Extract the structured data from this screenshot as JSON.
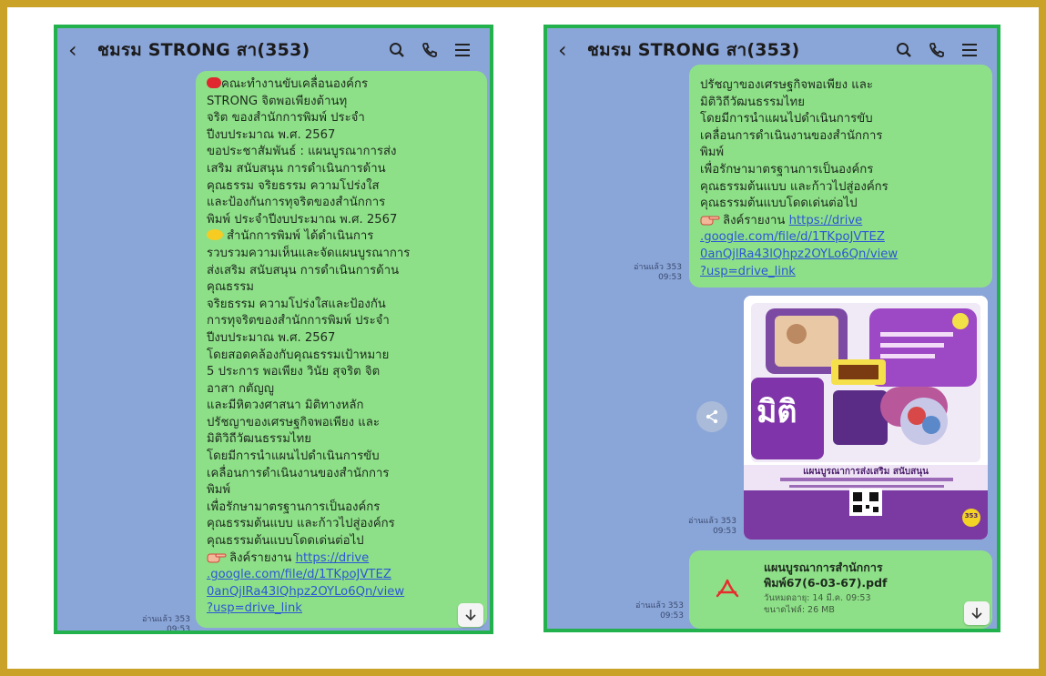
{
  "header": {
    "title": "ชมรม STRONG สา(353)"
  },
  "left": {
    "lines": [
      "คณะทำงานขับเคลื่อนองค์กร",
      "STRONG จิตพอเพียงต้านทุ",
      "จริต ของสำนักการพิมพ์ ประจำ",
      "ปีงบประมาณ พ.ศ. 2567",
      "ขอประชาสัมพันธ์ : แผนบูรณาการส่ง",
      "เสริม สนับสนุน การดำเนินการด้าน",
      "คุณธรรม จริยธรรม ความโปร่งใส",
      "และป้องกันการทุจริตของสำนักการ",
      "พิมพ์ ประจำปีงบประมาณ พ.ศ. 2567",
      "สำนักการพิมพ์ ได้ดำเนินการ",
      "รวบรวมความเห็นและจัดแผนบูรณาการ",
      "ส่งเสริม สนับสนุน การดำเนินการด้าน",
      "คุณธรรม",
      "จริยธรรม ความโปร่งใสและป้องกัน",
      "การทุจริตของสำนักการพิมพ์ ประจำ",
      "ปีงบประมาณ พ.ศ. 2567",
      "โดยสอดคล้องกับคุณธรรมเป้าหมาย",
      "5 ประการ พอเพียง วินัย สุจริต จิต",
      "อาสา กตัญญู",
      "และมีหิตวงศาสนา มิติทางหลัก",
      "ปรัชญาของเศรษฐกิจพอเพียง และ",
      "มิติวิถีวัฒนธรรมไทย",
      "โดยมีการนำแผนไปดำเนินการขับ",
      "เคลื่อนการดำเนินงานของสำนักการ",
      "พิมพ์",
      "เพื่อรักษามาตรฐานการเป็นองค์กร",
      "คุณธรรมต้นแบบ และก้าวไปสู่องค์กร",
      "คุณธรรมต้นแบบโดดเด่นต่อไป"
    ],
    "link_label": "ลิงค์รายงาน",
    "link_url_lines": [
      "https://drive",
      ".google.com/file/d/1TKpoJVTEZ",
      "0anQjlRa43lQhpz2OYLo6Qn/view",
      "?usp=drive_link"
    ],
    "timestamp": [
      "อ่านแล้ว 353",
      "09:53"
    ]
  },
  "right": {
    "lines": [
      "ปรัชญาของเศรษฐกิจพอเพียง และ",
      "มิติวิถีวัฒนธรรมไทย",
      "โดยมีการนำแผนไปดำเนินการขับ",
      "เคลื่อนการดำเนินงานของสำนักการ",
      "พิมพ์",
      "เพื่อรักษามาตรฐานการเป็นองค์กร",
      "คุณธรรมต้นแบบ และก้าวไปสู่องค์กร",
      "คุณธรรมต้นแบบโดดเด่นต่อไป"
    ],
    "link_label": "ลิงค์รายงาน",
    "link_url_lines": [
      "https://drive",
      ".google.com/file/d/1TKpoJVTEZ",
      "0anQjlRa43lQhpz2OYLo6Qn/view",
      "?usp=drive_link"
    ],
    "timestamp_1": [
      "อ่านแล้ว 353",
      "09:53"
    ],
    "timestamp_2": [
      "อ่านแล้ว 353",
      "09:53"
    ],
    "timestamp_3": [
      "อ่านแล้ว 353",
      "09:53"
    ],
    "poster": {
      "big_text": "มิติ",
      "bottom_title": "แผนบูรณาการส่งเสริม สนับสนุน",
      "badge": "353"
    },
    "file": {
      "name_line1": "แผนบูรณาการสำนักการ",
      "name_line2": "พิมพ์67(6-03-67).pdf",
      "expiry": "วันหมดอายุ: 14 มี.ค. 09:53",
      "size": "ขนาดไฟล์: 26 MB"
    }
  },
  "colors": {
    "chat_background": "#8aa5d8",
    "bubble": "#8ee088",
    "panel_border": "#23b14d",
    "outer_border": "#c9a227",
    "link": "#2c56d6"
  },
  "icons": [
    "back-arrow-icon",
    "search-icon",
    "phone-icon",
    "menu-icon",
    "share-icon",
    "pdf-icon",
    "scroll-down-icon"
  ]
}
